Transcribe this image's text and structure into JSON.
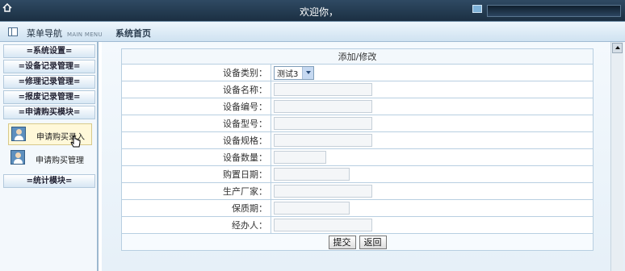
{
  "header": {
    "welcome": "欢迎你，"
  },
  "subbar": {
    "menu_title": "菜单导航",
    "menu_subtitle": "MAIN MENU",
    "page_title": "系统首页"
  },
  "sidebar": {
    "sections": [
      {
        "label": "=系统设置="
      },
      {
        "label": "=设备记录管理="
      },
      {
        "label": "=修理记录管理="
      },
      {
        "label": "=报废记录管理="
      },
      {
        "label": "=申请购买模块="
      },
      {
        "label": "=统计模块="
      }
    ],
    "sub_items": [
      {
        "label": "申请购买录入",
        "active": true
      },
      {
        "label": "申请购买管理",
        "active": false
      }
    ]
  },
  "form": {
    "title": "添加/修改",
    "category_label": "设备类别：",
    "category_value": "测试3",
    "name_label": "设备名称：",
    "number_label": "设备编号：",
    "model_label": "设备型号：",
    "spec_label": "设备规格：",
    "quantity_label": "设备数量：",
    "purchase_date_label": "购置日期：",
    "manufacturer_label": "生产厂家：",
    "warranty_label": "保质期：",
    "handler_label": "经办人：",
    "submit_label": "提交",
    "back_label": "返回"
  }
}
